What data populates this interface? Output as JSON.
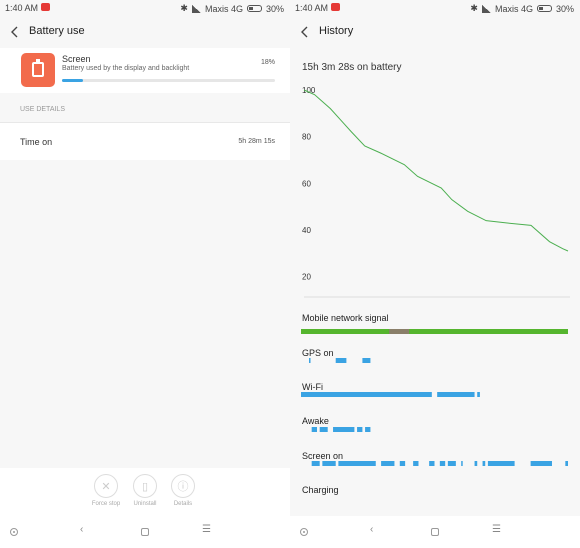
{
  "status": {
    "time": "1:40",
    "ampm": "AM",
    "carrier": "Maxis 4G",
    "battery": "30%",
    "battery_level": 0.3
  },
  "left": {
    "title": "Battery  use",
    "app": {
      "name": "Screen",
      "description": "Battery used by the display and backlight",
      "percent": "18%",
      "usage_fraction": 0.18
    },
    "section": "USE DETAILS",
    "row": {
      "label": "Time on",
      "value": "5h 28m 15s"
    },
    "actions": [
      {
        "label": "Force stop",
        "icon": "close-icon"
      },
      {
        "label": "Uninstall",
        "icon": "trash-icon"
      },
      {
        "label": "Details",
        "icon": "info-icon"
      }
    ]
  },
  "right": {
    "title": "History",
    "subtitle": "15h 3m 28s on battery",
    "rows": [
      {
        "label": "Mobile network signal"
      },
      {
        "label": "GPS on"
      },
      {
        "label": "Wi-Fi"
      },
      {
        "label": "Awake"
      },
      {
        "label": "Screen on"
      },
      {
        "label": "Charging"
      }
    ]
  },
  "chart_data": {
    "type": "line",
    "title": "",
    "xlabel": "",
    "ylabel": "",
    "ylim": [
      10,
      100
    ],
    "yticks": [
      20,
      40,
      60,
      80,
      100
    ],
    "grid": false,
    "series": [
      {
        "color": "#4caf50",
        "x": [
          0,
          0.04,
          0.1,
          0.14,
          0.18,
          0.23,
          0.29,
          0.38,
          0.43,
          0.52,
          0.56,
          0.62,
          0.69,
          0.77,
          0.86,
          0.93,
          0.98,
          1.0
        ],
        "values": [
          100,
          98,
          92,
          87,
          82,
          76,
          73,
          68,
          63,
          58,
          53,
          48,
          44,
          43,
          42,
          35,
          32,
          31
        ]
      }
    ],
    "timeline_bars": {
      "Mobile network signal": [
        [
          0,
          1
        ]
      ],
      "GPS on": [
        [
          0.03,
          0.035
        ],
        [
          0.13,
          0.17
        ],
        [
          0.23,
          0.26
        ]
      ],
      "Wi-Fi": [
        [
          0,
          0.49
        ],
        [
          0.51,
          0.65
        ],
        [
          0.66,
          0.67
        ]
      ],
      "Awake": [
        [
          0.04,
          0.06
        ],
        [
          0.07,
          0.1
        ],
        [
          0.12,
          0.2
        ],
        [
          0.21,
          0.23
        ],
        [
          0.24,
          0.26
        ]
      ],
      "Screen on": [
        [
          0.04,
          0.07
        ],
        [
          0.08,
          0.13
        ],
        [
          0.14,
          0.28
        ],
        [
          0.3,
          0.35
        ],
        [
          0.37,
          0.39
        ],
        [
          0.42,
          0.44
        ],
        [
          0.48,
          0.5
        ],
        [
          0.52,
          0.54
        ],
        [
          0.55,
          0.58
        ],
        [
          0.6,
          0.6
        ],
        [
          0.65,
          0.66
        ],
        [
          0.68,
          0.69
        ],
        [
          0.7,
          0.8
        ],
        [
          0.86,
          0.94
        ],
        [
          0.99,
          1.0
        ]
      ]
    }
  },
  "colors": {
    "accent": "#3aa3e3",
    "app_icon": "#f26b4c",
    "line": "#4caf50",
    "signal_bar": "#55b52e"
  }
}
